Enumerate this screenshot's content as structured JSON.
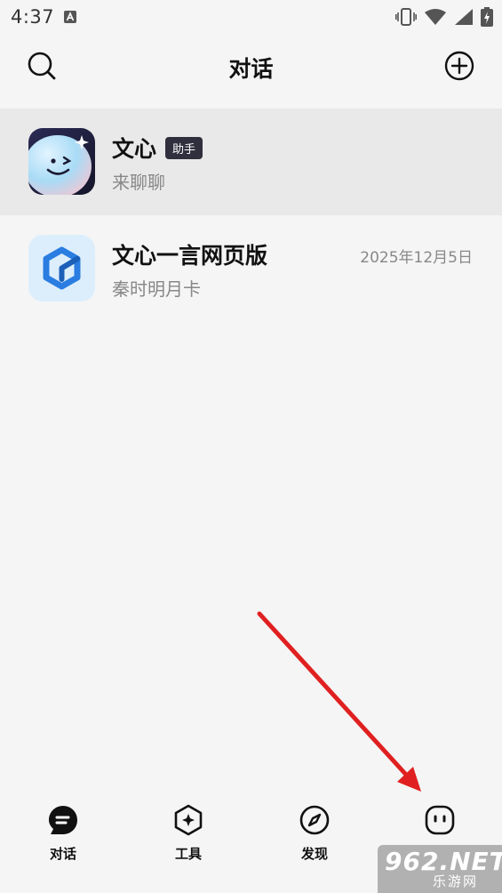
{
  "status_bar": {
    "time": "4:37",
    "notification_icon": "a-text-icon",
    "vibrate_icon": "vibrate-icon",
    "wifi_icon": "wifi-icon",
    "signal_icon": "signal-icon",
    "battery_icon": "battery-charging-icon"
  },
  "header": {
    "title": "对话",
    "search_icon": "search-icon",
    "add_icon": "plus-circle-icon"
  },
  "conversations": [
    {
      "name": "文心",
      "badge": "助手",
      "subtitle": "来聊聊",
      "time": "",
      "selected": true
    },
    {
      "name": "文心一言网页版",
      "badge": "",
      "subtitle": "秦时明月卡",
      "time": "2025年12月5日",
      "selected": false
    }
  ],
  "tabs": [
    {
      "label": "对话",
      "icon": "chat-bubble-icon",
      "active": true
    },
    {
      "label": "工具",
      "icon": "sparkle-hexagon-icon",
      "active": false
    },
    {
      "label": "发现",
      "icon": "compass-icon",
      "active": false
    },
    {
      "label": "",
      "icon": "face-icon",
      "active": false
    }
  ],
  "watermark": {
    "main": "962.NET",
    "sub": "乐游网"
  },
  "colors": {
    "background": "#f5f5f5",
    "selected_row": "#e9e9e9",
    "badge_bg": "#2f2f3e",
    "arrow": "#e02020"
  }
}
